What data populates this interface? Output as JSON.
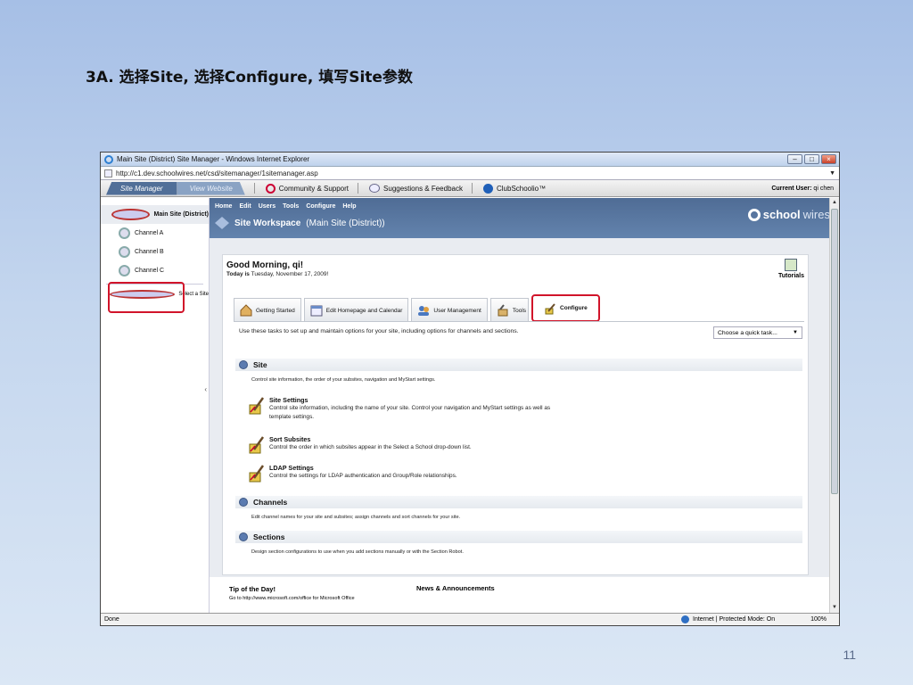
{
  "slide": {
    "title": "3A.  选择Site, 选择Configure, 填写Site参数",
    "page_number": "11"
  },
  "browser": {
    "window_title": "Main Site (District) Site Manager - Windows Internet Explorer",
    "url": "http://c1.dev.schoolwires.net/csd/sitemanager/1sitemanager.asp",
    "status_left": "Done",
    "status_zone": "Internet | Protected Mode: On",
    "zoom": "100%"
  },
  "topbar": {
    "site_manager_tab": "Site Manager",
    "view_website_tab": "View Website",
    "community": "Community & Support",
    "suggestions": "Suggestions & Feedback",
    "clubschoolio": "ClubSchoolio™",
    "current_user_label": "Current User:",
    "current_user": "qi chen"
  },
  "sidebar": {
    "main_site": "Main Site (District)",
    "channels": [
      "Channel A",
      "Channel B",
      "Channel C"
    ],
    "select_site": "Select a Site"
  },
  "header": {
    "menu": [
      "Home",
      "Edit",
      "Users",
      "Tools",
      "Configure",
      "Help"
    ],
    "workspace_title": "Site Workspace",
    "workspace_sub": "(Main Site (District))",
    "logo_bold": "school",
    "logo_rest": "wires"
  },
  "panel": {
    "greeting": "Good Morning, qi!",
    "today_label": "Today is",
    "today_date": "Tuesday, November 17, 2009!",
    "tutorials": "Tutorials",
    "tabs": [
      "Getting Started",
      "Edit Homepage and Calendar",
      "User Management",
      "Tools",
      "Configure"
    ],
    "intro": "Use these tasks to set up and maintain options for your site, including options for channels and sections.",
    "quick_task": "Choose a quick task...",
    "site_title": "Site",
    "site_desc": "Control site information, the order of your subsites, navigation and MyStart settings.",
    "items": [
      {
        "title": "Site Settings",
        "desc": "Control site information, including the name of your site. Control your navigation and MyStart settings as well as template settings."
      },
      {
        "title": "Sort Subsites",
        "desc": "Control the order in which subsites appear in the Select a School drop-down list."
      },
      {
        "title": "LDAP Settings",
        "desc": "Control the settings for LDAP authentication and Group/Role relationships."
      }
    ],
    "channels_title": "Channels",
    "channels_desc": "Edit channel names for your site and subsites; assign channels and sort channels for your site.",
    "sections_title": "Sections",
    "sections_desc": "Design section configurations to use when you add sections manually or with the Section Robot."
  },
  "bottom": {
    "tip_title": "Tip of the Day!",
    "tip_text": "Go to http://www.microsoft.com/office for Microsoft Office",
    "news_title": "News & Announcements"
  },
  "colors": {
    "highlight": "#d1142a",
    "header_blue": "#4f6c95"
  }
}
